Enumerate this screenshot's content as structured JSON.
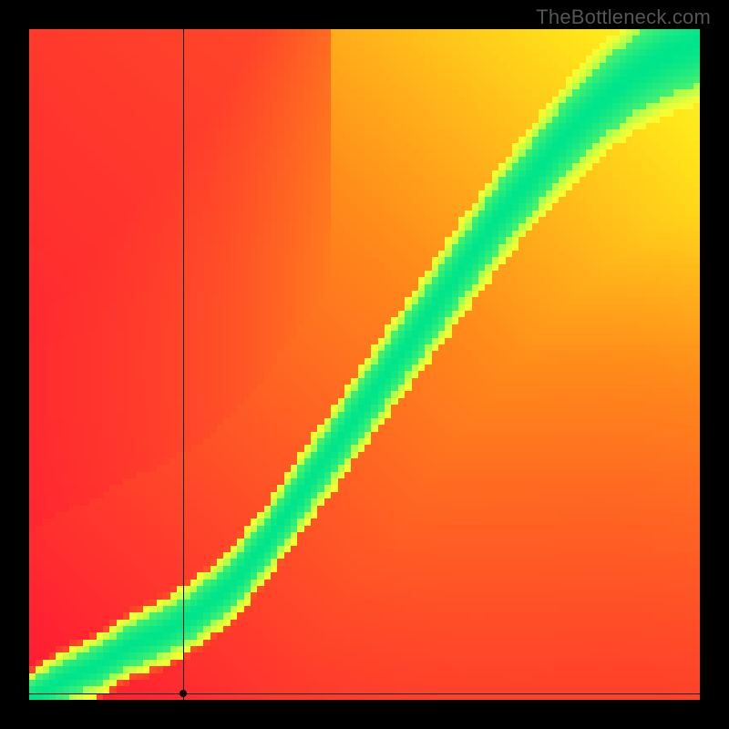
{
  "watermark": "TheBottleneck.com",
  "chart_data": {
    "type": "heatmap",
    "title": "",
    "xlabel": "",
    "ylabel": "",
    "xlim": [
      0,
      100
    ],
    "ylim": [
      0,
      100
    ],
    "grid": false,
    "legend": false,
    "resolution": 100,
    "color_stops": [
      {
        "t": 0.0,
        "color": "#ff1a33"
      },
      {
        "t": 0.45,
        "color": "#ff8a1a"
      },
      {
        "t": 0.72,
        "color": "#ffe61a"
      },
      {
        "t": 0.82,
        "color": "#f5ff33"
      },
      {
        "t": 0.93,
        "color": "#9dff52"
      },
      {
        "t": 1.0,
        "color": "#00e58a"
      }
    ],
    "ridge": {
      "description": "Nonlinear ideal-balance curve; the green band lies closest to this curve. Heatmap value is 1 on the curve, falling off with distance.",
      "x": [
        0,
        5,
        10,
        15,
        20,
        25,
        30,
        35,
        40,
        45,
        50,
        55,
        60,
        65,
        70,
        75,
        80,
        85,
        90,
        95,
        100
      ],
      "y": [
        0,
        3,
        5,
        8,
        10,
        13,
        17,
        23,
        30,
        37,
        44,
        51,
        58,
        65,
        72,
        78,
        84,
        89,
        93,
        96,
        98
      ]
    },
    "band_halfwidth_fraction": 0.055,
    "background_gradient": {
      "description": "Baseline warm gradient from bottom-left (red) toward upper-right (yellow)",
      "from": "#ff1a33",
      "to": "#ffe61a"
    },
    "crosshair": {
      "x": 23,
      "y": 1
    },
    "marker": {
      "x": 23,
      "y": 1
    }
  }
}
